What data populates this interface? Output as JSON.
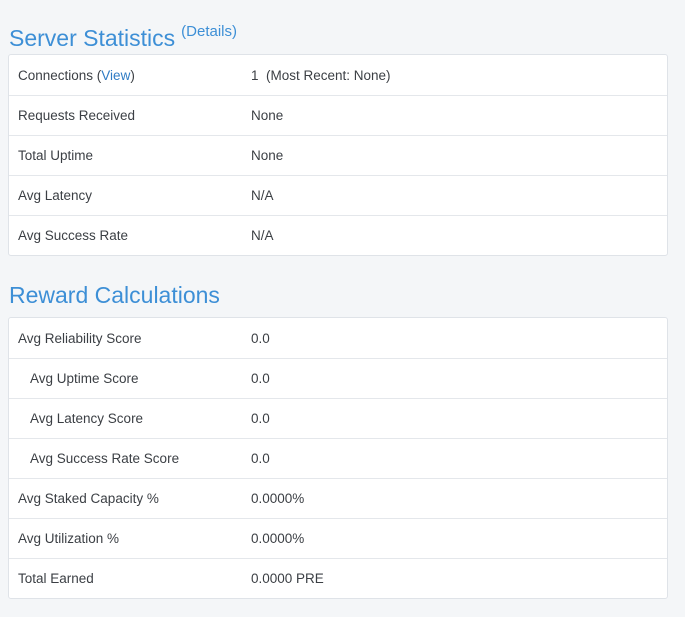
{
  "server_statistics": {
    "title": "Server Statistics",
    "details_open": "(",
    "details_link": "Details",
    "details_close": ")",
    "rows": [
      {
        "label": "Connections (",
        "link": "View",
        "label_suffix": ")",
        "value": "1  (Most Recent: None)"
      },
      {
        "label": "Requests Received",
        "value": "None"
      },
      {
        "label": "Total Uptime",
        "value": "None"
      },
      {
        "label": "Avg Latency",
        "value": "N/A"
      },
      {
        "label": "Avg Success Rate",
        "value": "N/A"
      }
    ]
  },
  "reward_calculations": {
    "title": "Reward Calculations",
    "rows": [
      {
        "label": "Avg Reliability Score",
        "value": "0.0"
      },
      {
        "label": "Avg Uptime Score",
        "value": "0.0"
      },
      {
        "label": "Avg Latency Score",
        "value": "0.0"
      },
      {
        "label": "Avg Success Rate Score",
        "value": "0.0"
      },
      {
        "label": "Avg Staked Capacity %",
        "value": "0.0000%"
      },
      {
        "label": "Avg Utilization %",
        "value": "0.0000%"
      },
      {
        "label": "Total Earned",
        "value": "0.0000 PRE"
      }
    ]
  }
}
